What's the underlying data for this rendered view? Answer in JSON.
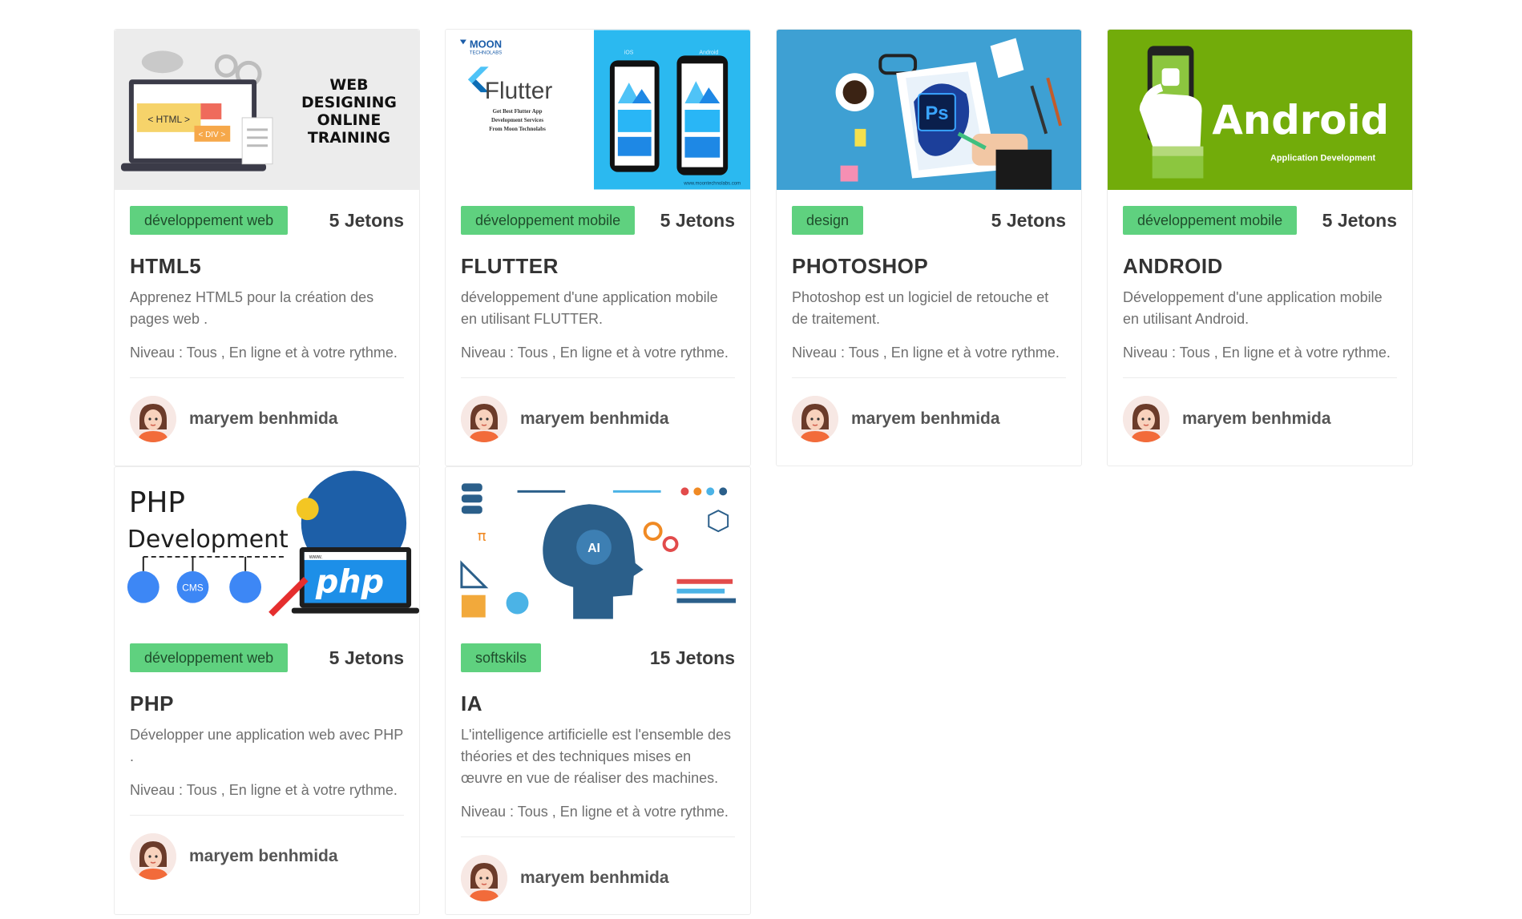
{
  "courses": [
    {
      "category": "développement web",
      "tokens": "5 Jetons",
      "title": "HTML5",
      "description": "Apprenez HTML5 pour la création des pages web .",
      "level": "Niveau : Tous , En ligne et à votre rythme.",
      "author": "maryem benhmida",
      "image_text": [
        "WEB",
        "DESIGNING",
        "ONLINE",
        "TRAINING"
      ],
      "image_labels": [
        "< HTML >",
        "< DIV >"
      ]
    },
    {
      "category": "développement mobile",
      "tokens": "5 Jetons",
      "title": "FLUTTER",
      "description": "développement d'une application mobile en utilisant FLUTTER.",
      "level": "Niveau : Tous , En ligne et à votre rythme.",
      "author": "maryem benhmida",
      "image_brand": "MOON",
      "image_brand_sub": "TECHNOLABS",
      "image_title": "Flutter",
      "image_lines": [
        "Get Best Flutter App",
        "Development Services",
        "From Moon Technolabs"
      ],
      "image_os": [
        "iOS",
        "Android"
      ],
      "image_url": "www.moontechnolabs.com"
    },
    {
      "category": "design",
      "tokens": "5 Jetons",
      "title": "PHOTOSHOP",
      "description": "Photoshop est un logiciel de retouche et de traitement.",
      "level": "Niveau : Tous , En ligne et à votre rythme.",
      "author": "maryem benhmida",
      "image_logo": "Ps"
    },
    {
      "category": "développement mobile",
      "tokens": "5 Jetons",
      "title": "ANDROID",
      "description": "Développement d'une application mobile en utilisant Android.",
      "level": "Niveau : Tous , En ligne et à votre rythme.",
      "author": "maryem benhmida",
      "image_title": "Android",
      "image_sub": "Application Development"
    },
    {
      "category": "développement web",
      "tokens": "5 Jetons",
      "title": "PHP",
      "description": "Développer une application web avec PHP .",
      "level": "Niveau : Tous , En ligne et à votre rythme.",
      "author": "maryem benhmida",
      "image_title": [
        "PHP",
        "Development"
      ],
      "image_logo": "php",
      "image_cms": "CMS",
      "image_url": "www."
    },
    {
      "category": "softskils",
      "tokens": "15 Jetons",
      "title": "IA",
      "description": "L'intelligence artificielle est l'ensemble des théories et des techniques mises en œuvre en vue de réaliser des machines.",
      "level": "Niveau : Tous , En ligne et à votre rythme.",
      "author": "maryem benhmida",
      "image_label": "AI",
      "image_pi": "π"
    }
  ],
  "colors": {
    "badge": "#5fd17f",
    "android_green": "#72ac0a",
    "photoshop_blue": "#3ea0d3",
    "flutter_cyan": "#2bb9f0"
  }
}
